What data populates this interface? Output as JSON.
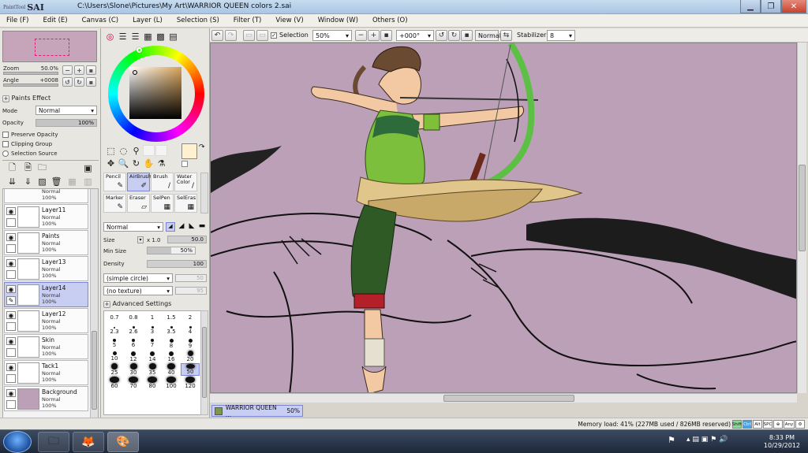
{
  "window": {
    "app_name": "SAI",
    "app_subname": "PaintTool",
    "title": "C:\\Users\\Slone\\Pictures\\My Art\\WARRIOR QUEEN colors 2.sai"
  },
  "menu": [
    "File (F)",
    "Edit (E)",
    "Canvas (C)",
    "Layer (L)",
    "Selection (S)",
    "Filter (T)",
    "View (V)",
    "Window (W)",
    "Others (O)"
  ],
  "navigator": {
    "zoom_label": "Zoom",
    "zoom_value": "50.0%",
    "angle_label": "Angle",
    "angle_value": "+0008"
  },
  "layer_props": {
    "paints_effect": "Paints Effect",
    "mode_label": "Mode",
    "mode_value": "Normal",
    "opacity_label": "Opacity",
    "opacity_value": "100%",
    "preserve_opacity": "Preserve Opacity",
    "clipping_group": "Clipping Group",
    "selection_source": "Selection Source"
  },
  "layers": [
    {
      "name": "Layer11",
      "mode": "Normal",
      "opacity": "100%",
      "selected": false
    },
    {
      "name": "Paints",
      "mode": "Normal",
      "opacity": "100%",
      "selected": false
    },
    {
      "name": "Layer13",
      "mode": "Normal",
      "opacity": "100%",
      "selected": false
    },
    {
      "name": "Layer14",
      "mode": "Normal",
      "opacity": "100%",
      "selected": true
    },
    {
      "name": "Layer12",
      "mode": "Normal",
      "opacity": "100%",
      "selected": false
    },
    {
      "name": "Skin",
      "mode": "Normal",
      "opacity": "100%",
      "selected": false
    },
    {
      "name": "Tack1",
      "mode": "Normal",
      "opacity": "100%",
      "selected": false
    },
    {
      "name": "Background",
      "mode": "Normal",
      "opacity": "100%",
      "selected": false
    }
  ],
  "layer_partial_top": {
    "mode": "Normal",
    "opacity": "100%"
  },
  "brushes": [
    {
      "name": "Pencil",
      "icon": "✎"
    },
    {
      "name": "AirBrush",
      "icon": "✐"
    },
    {
      "name": "Brush",
      "icon": "🖌"
    },
    {
      "name": "Water Color",
      "icon": "✒"
    },
    {
      "name": "Marker",
      "icon": "✎"
    },
    {
      "name": "Eraser",
      "icon": "▱"
    },
    {
      "name": "SelPen",
      "icon": "✐"
    },
    {
      "name": "SelEras",
      "icon": "✐"
    }
  ],
  "brush_settings": {
    "blend_mode": "Normal",
    "size_label": "Size",
    "size_mult": "x 1.0",
    "size_value": "50.0",
    "minsize_label": "Min Size",
    "minsize_value": "50%",
    "density_label": "Density",
    "density_value": "100",
    "shape": "(simple circle)",
    "shape_val": "50",
    "texture": "(no texture)",
    "texture_val": "95",
    "advanced": "Advanced Settings"
  },
  "brush_sizes": [
    "0.7",
    "0.8",
    "1",
    "1.5",
    "2",
    "2.3",
    "2.6",
    "3",
    "3.5",
    "4",
    "5",
    "6",
    "7",
    "8",
    "9",
    "10",
    "12",
    "14",
    "16",
    "20",
    "25",
    "30",
    "35",
    "40",
    "50",
    "60",
    "70",
    "80",
    "100",
    "120"
  ],
  "toolbar": {
    "selection_label": "Selection",
    "zoom": "50%",
    "angle": "+000°",
    "blend": "Normal",
    "stabilizer_label": "Stabilizer",
    "stabilizer_value": "8"
  },
  "doc_tab": {
    "name": "WARRIOR QUEEN ...",
    "zoom": "50%"
  },
  "status": {
    "memory": "Memory load: 41% (227MB used / 826MB reserved)",
    "keys": [
      "Shift",
      "Ctrl",
      "Alt",
      "SPC",
      "⊕",
      "Any"
    ]
  },
  "taskbar": {
    "time": "8:33 PM",
    "date": "10/29/2012"
  },
  "colors": {
    "canvas_bg": "#bba0b7",
    "selection": "#c8cdf2",
    "primary": "#fff0d0"
  }
}
